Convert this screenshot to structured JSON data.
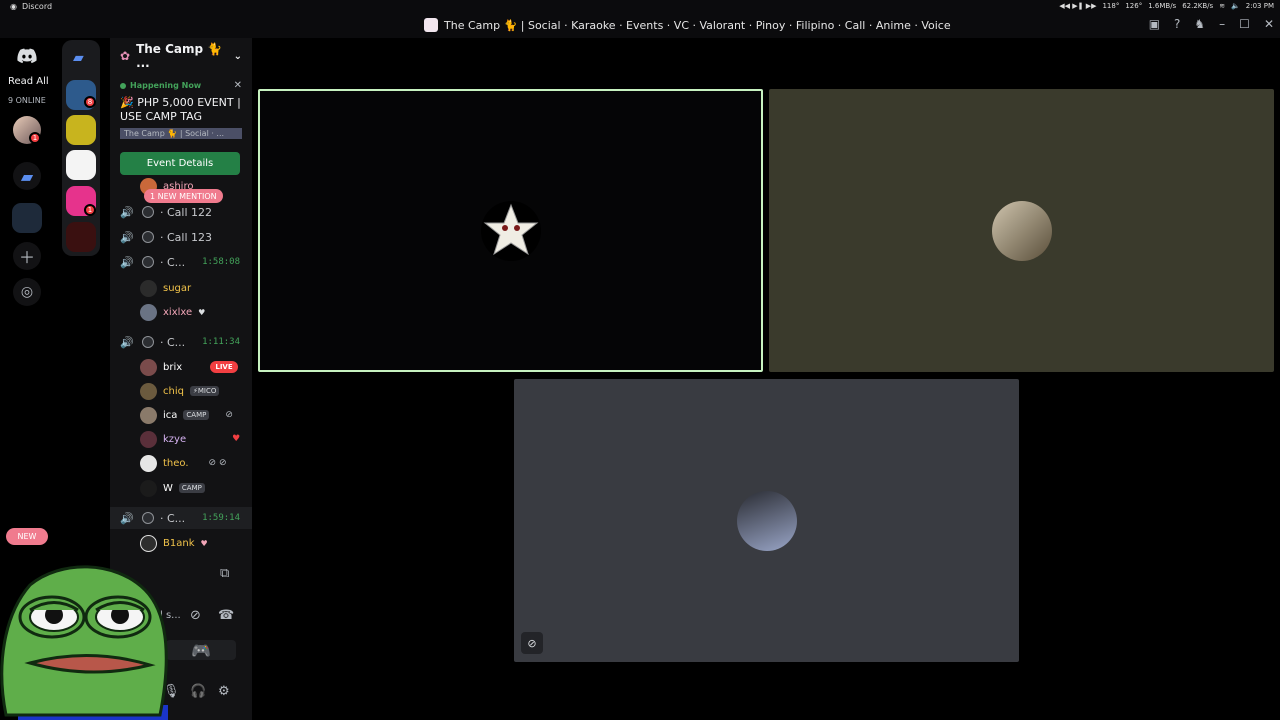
{
  "topbar": {
    "app_name": "Discord",
    "net_up": "1.6MB/s",
    "net_down": "62.2KB/s",
    "temp_a": "118°",
    "temp_b": "126°",
    "clock": "2:03 PM"
  },
  "titlebar": {
    "title": "The Camp 🐈 | Social · Karaoke · Events · VC · Valorant · Pinoy · Filipino · Call · Anime · Voice"
  },
  "rail": {
    "read_all": "Read All",
    "online": "9 ONLINE",
    "dm_badge": "1",
    "new_label": "NEW"
  },
  "servers": [
    {
      "badge": "8",
      "color": "#2d5a8c"
    },
    {
      "badge": "",
      "color": "#c8b41e"
    },
    {
      "badge": "",
      "color": "#f4f4f4"
    },
    {
      "badge": "1",
      "color": "#e6338c"
    },
    {
      "badge": "",
      "color": "#3a1010"
    }
  ],
  "server": {
    "name": "The Camp 🐈 ..."
  },
  "event": {
    "status": "Happening Now",
    "title": "🎉 PHP 5,000 EVENT | USE CAMP TAG",
    "location": "The Camp 🐈 | Social · ...",
    "button": "Event Details"
  },
  "mention_pill": "1 NEW MENTION",
  "channels": [
    {
      "name": "· Call 122",
      "timer": ""
    },
    {
      "name": "· Call 123",
      "timer": ""
    },
    {
      "name": "· C...",
      "timer": "1:58:08"
    },
    {
      "name": "· C...",
      "timer": "1:11:34"
    },
    {
      "name": "· C...",
      "timer": "1:59:14"
    }
  ],
  "users": [
    {
      "name": "ashiro",
      "tag": ""
    },
    {
      "name": "sugar",
      "tag": ""
    },
    {
      "name": "xixlxe",
      "tag": ""
    },
    {
      "name": "brix",
      "tag": "LIVE"
    },
    {
      "name": "chiq",
      "tag": "⚡MICO"
    },
    {
      "name": "ica",
      "tag": "CAMP"
    },
    {
      "name": "kzye",
      "tag": ""
    },
    {
      "name": "theo.",
      "tag": ""
    },
    {
      "name": "W",
      "tag": "CAMP"
    },
    {
      "name": "B1ank",
      "tag": ""
    }
  ],
  "voice_panel": {
    "status_text": "l s..."
  },
  "stage": {
    "tile_colors": [
      "#050506",
      "#3a3a2c",
      "#393b41"
    ]
  }
}
